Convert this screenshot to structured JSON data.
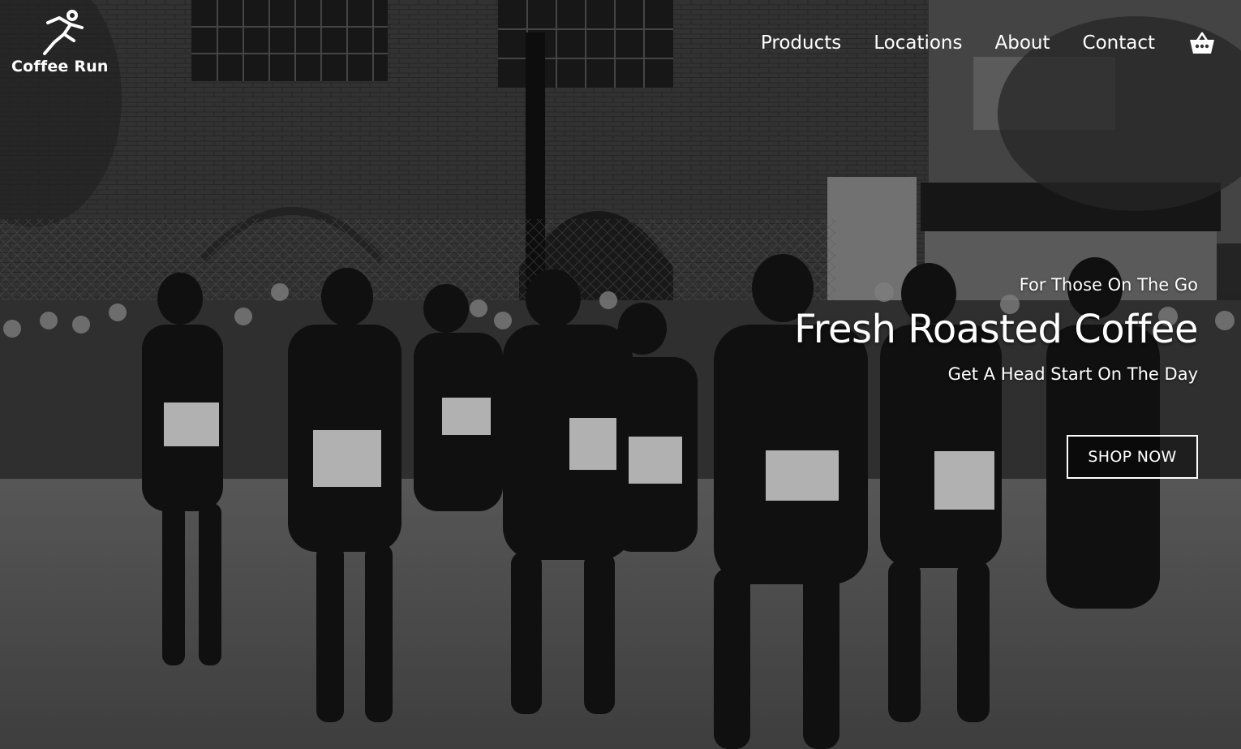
{
  "brand": {
    "name": "Coffee Run",
    "logo_icon": "running-figure-icon"
  },
  "nav": {
    "items": [
      {
        "label": "Products"
      },
      {
        "label": "Locations"
      },
      {
        "label": "About"
      },
      {
        "label": "Contact"
      }
    ],
    "cart_icon": "shopping-basket-icon"
  },
  "hero": {
    "kicker": "For Those On The Go",
    "headline": "Fresh Roasted Coffee",
    "subline": "Get A Head Start On The Day",
    "cta_label": "SHOP NOW",
    "background": "grayscale photo of marathon runners on a city street with cheering crowd"
  },
  "colors": {
    "text": "#ffffff",
    "overlay": "#000000"
  }
}
